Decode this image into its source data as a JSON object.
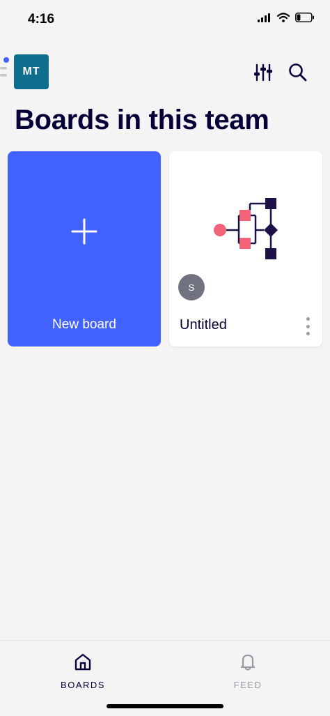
{
  "status_bar": {
    "time": "4:16",
    "battery_level": 0.25
  },
  "header": {
    "team_avatar": "MT"
  },
  "page": {
    "title": "Boards in this team"
  },
  "cards": {
    "new_board": {
      "label": "New board",
      "icon": "plus-icon"
    },
    "board": {
      "title": "Untitled",
      "owner_initial": "S",
      "menu_icon": "more-vertical-icon"
    }
  },
  "nav": {
    "boards": {
      "label": "BOARDS",
      "icon": "home-icon"
    },
    "feed": {
      "label": "FEED",
      "icon": "bell-icon"
    }
  },
  "colors": {
    "accent": "#4262ff",
    "team_avatar": "#0f6d8f",
    "thumb_pink": "#f2647a",
    "thumb_navy": "#1d1148"
  }
}
